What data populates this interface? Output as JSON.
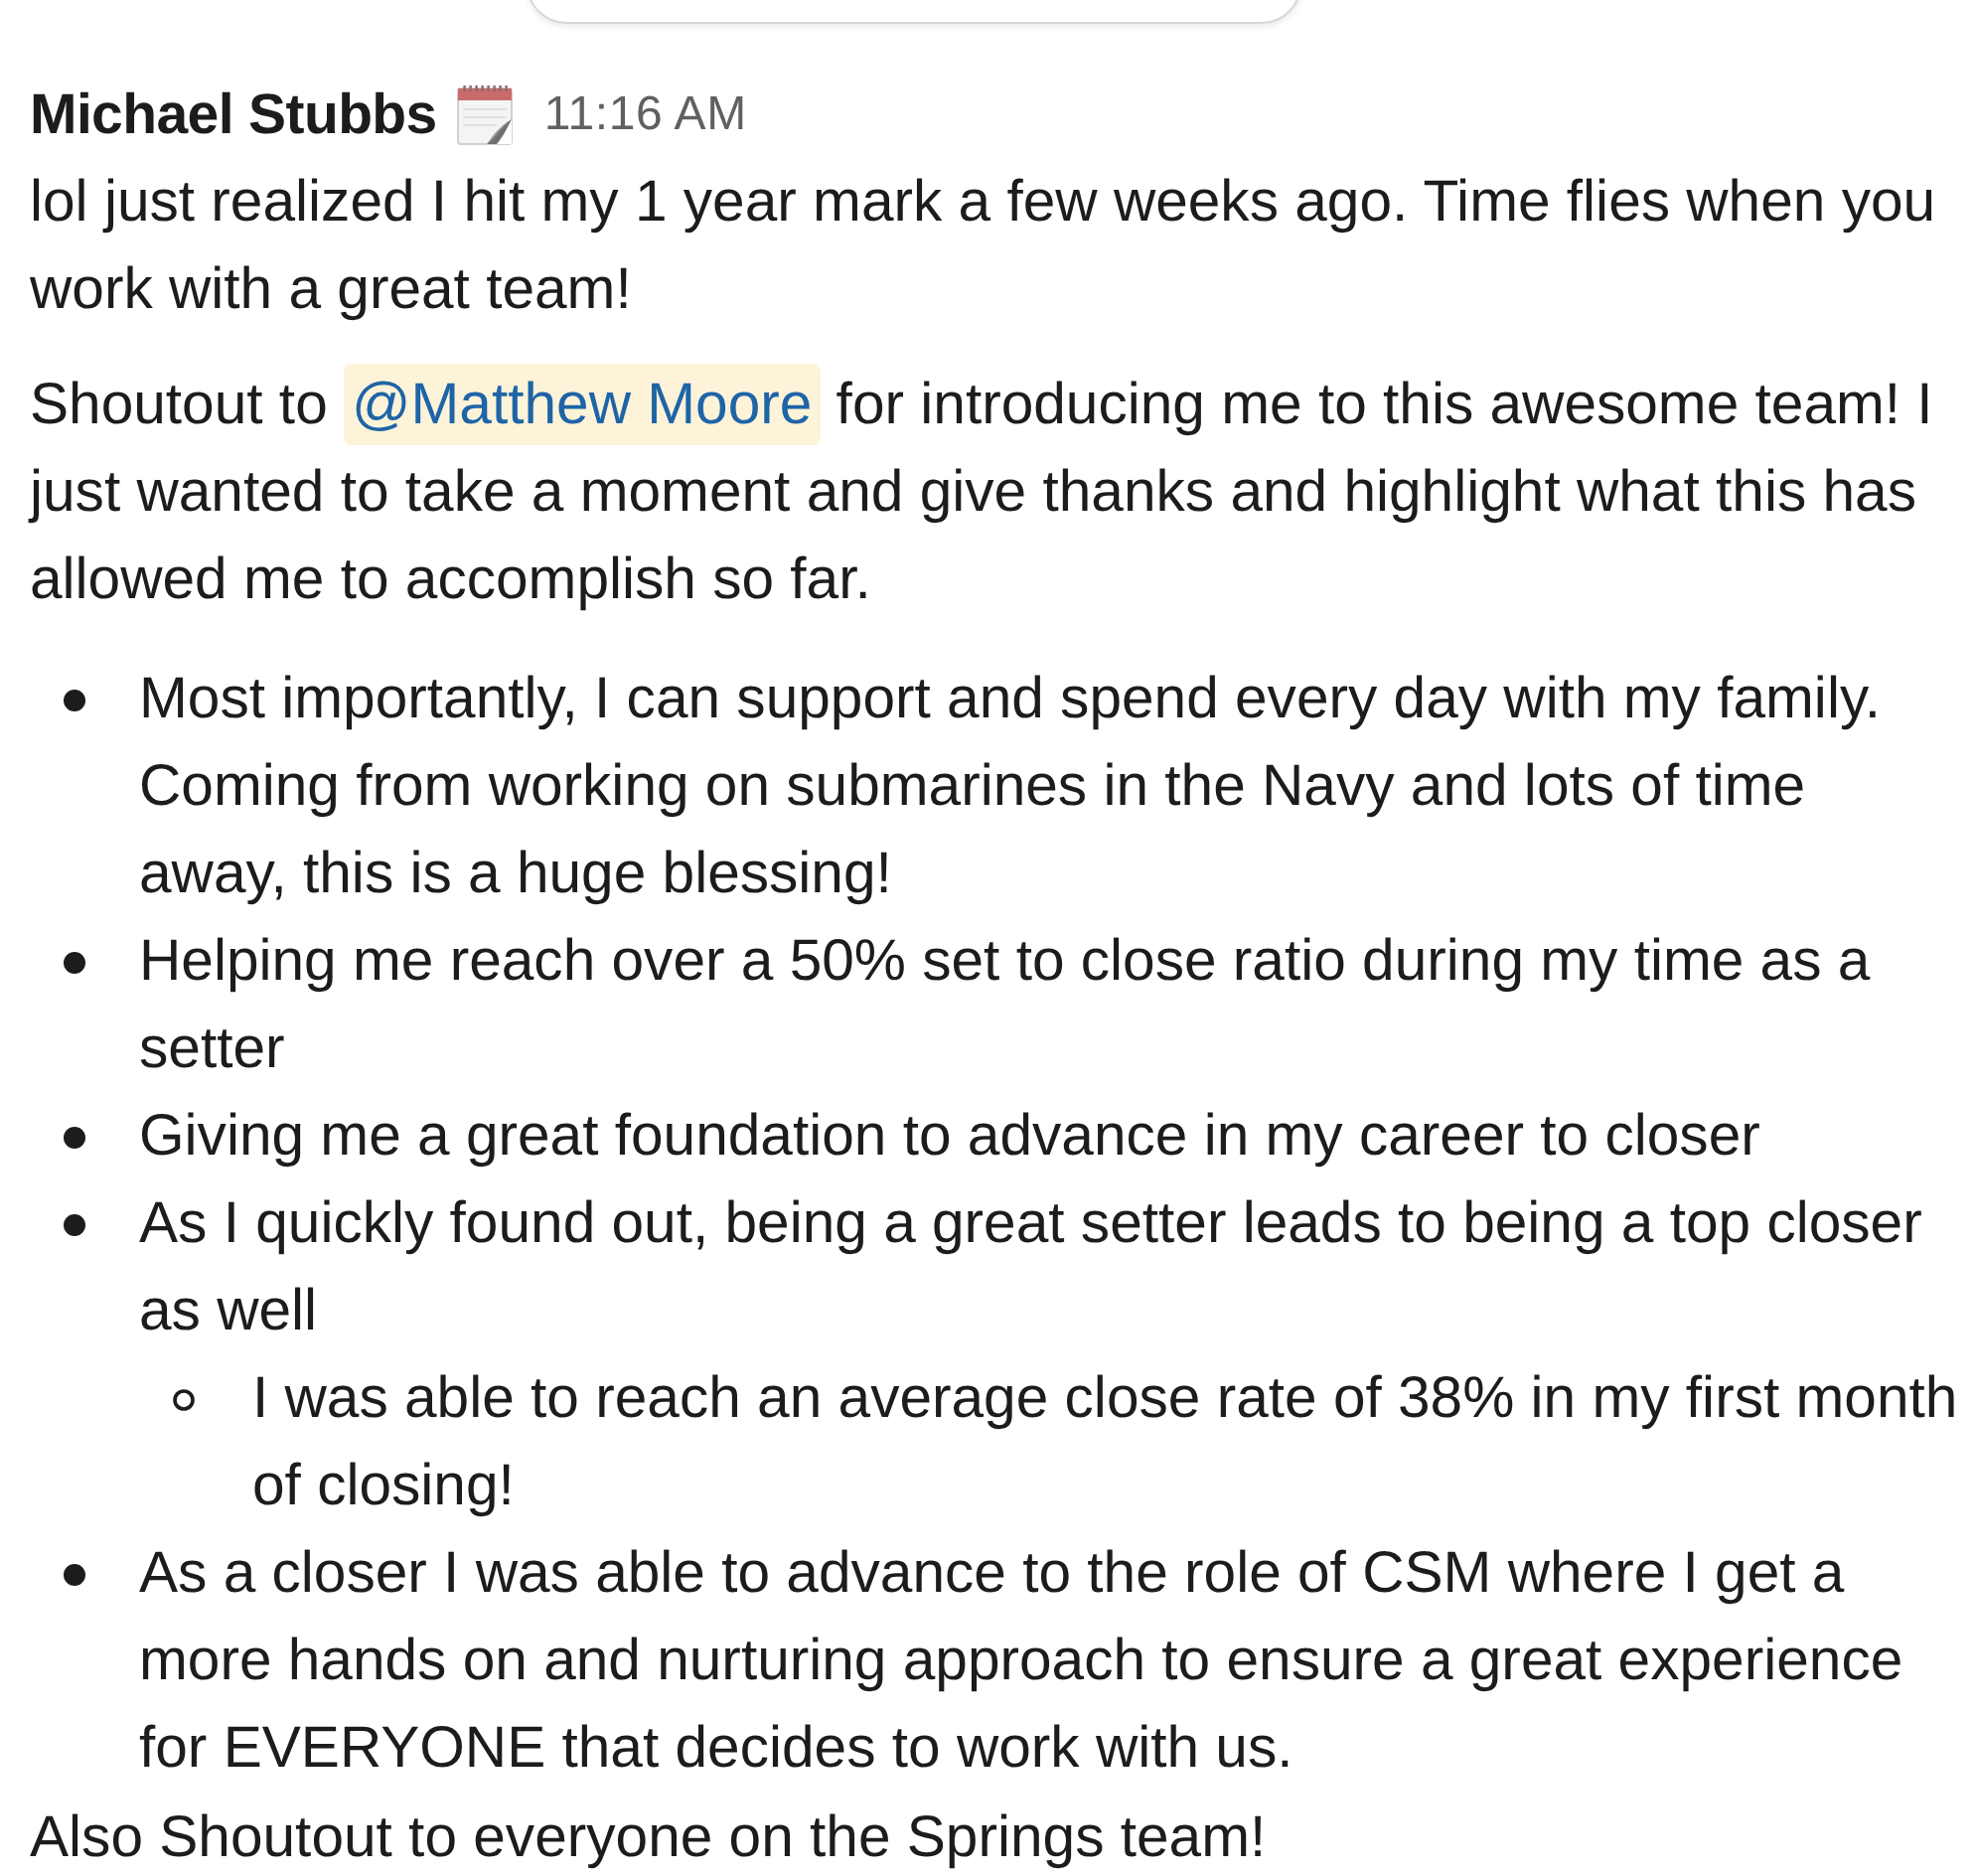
{
  "message": {
    "author": "Michael Stubbs",
    "time": "11:16 AM",
    "blocks": [
      {
        "kind": "paragraph",
        "text": "lol just realized I hit my 1 year mark a few weeks ago. Time flies when you work with a great team!"
      },
      {
        "kind": "paragraph",
        "segments": [
          {
            "kind": "text",
            "text": "Shoutout to "
          },
          {
            "kind": "mention",
            "text": "@Matthew Moore"
          },
          {
            "kind": "text",
            "text": " for introducing me to this awesome team! I just wanted to take a moment and give thanks and highlight what this has allowed me to accomplish so far."
          }
        ]
      },
      {
        "kind": "list",
        "items": [
          {
            "text": "Most importantly, I can support and spend every day with my family. Coming from working on submarines in the Navy and lots of time away, this is a huge blessing!"
          },
          {
            "text": "Helping me reach over a 50% set to close ratio during my time as a setter"
          },
          {
            "text": "Giving me a great foundation to advance in my career to closer"
          },
          {
            "text": "As I quickly found out, being a great setter leads to being a top closer as well",
            "children": [
              {
                "text": "I was able to reach an average close rate of 38% in my first month of closing!"
              }
            ]
          },
          {
            "text": "As a closer I was able to advance to the role of CSM where I get a more hands on and nurturing approach to ensure a great experience for EVERYONE that decides to work with us."
          }
        ]
      },
      {
        "kind": "paragraph",
        "text": "Also Shoutout to everyone on the Springs team!"
      }
    ]
  }
}
